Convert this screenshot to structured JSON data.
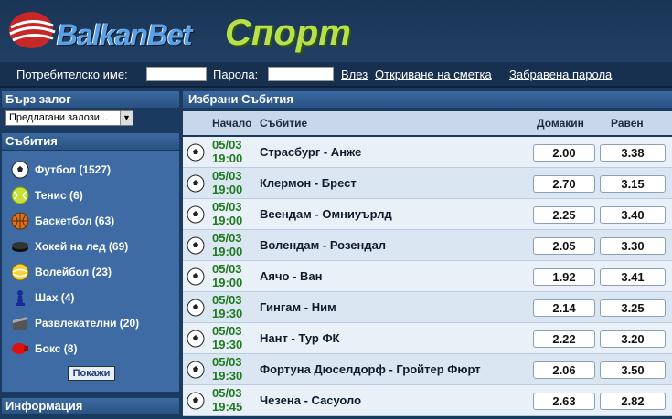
{
  "header": {
    "logo_name": "BalkanBet",
    "logo_sport": "Спорт"
  },
  "login": {
    "username_label": "Потребителско име:",
    "password_label": "Парола:",
    "login_link": "Влез",
    "open_account_link": "Откриване на сметка",
    "forgot_password_link": "Забравена парола"
  },
  "sidebar": {
    "quick_bet_title": "Бърз залог",
    "quick_bet_select": "Предлагани залози...",
    "events_title": "Събития",
    "sports": [
      {
        "label": "Футбол (1527)",
        "icon": "football-icon"
      },
      {
        "label": "Тенис (6)",
        "icon": "tennis-icon"
      },
      {
        "label": "Баскетбол (63)",
        "icon": "basketball-icon"
      },
      {
        "label": "Хокей на лед (69)",
        "icon": "hockey-puck-icon"
      },
      {
        "label": "Волейбол (23)",
        "icon": "volleyball-icon"
      },
      {
        "label": "Шах (4)",
        "icon": "chess-pawn-icon"
      },
      {
        "label": "Развлекателни (20)",
        "icon": "entertainment-icon"
      },
      {
        "label": "Бокс (8)",
        "icon": "boxing-glove-icon"
      }
    ],
    "show_button": "Покажи",
    "info_title": "Информация"
  },
  "main": {
    "title": "Избрани Събития",
    "columns": {
      "start": "Начало",
      "event": "Събитие",
      "home": "Домакин",
      "draw": "Равен"
    },
    "events": [
      {
        "date": "05/03",
        "time": "19:00",
        "event": "Страсбург - Анже",
        "home": "2.00",
        "draw": "3.38"
      },
      {
        "date": "05/03",
        "time": "19:00",
        "event": "Клермон - Брест",
        "home": "2.70",
        "draw": "3.15"
      },
      {
        "date": "05/03",
        "time": "19:00",
        "event": "Веендам - Омниуърлд",
        "home": "2.25",
        "draw": "3.40"
      },
      {
        "date": "05/03",
        "time": "19:00",
        "event": "Волендам - Розендал",
        "home": "2.05",
        "draw": "3.30"
      },
      {
        "date": "05/03",
        "time": "19:00",
        "event": "Аячо - Ван",
        "home": "1.92",
        "draw": "3.41"
      },
      {
        "date": "05/03",
        "time": "19:30",
        "event": "Гингам - Ним",
        "home": "2.14",
        "draw": "3.25"
      },
      {
        "date": "05/03",
        "time": "19:30",
        "event": "Нант - Тур ФК",
        "home": "2.22",
        "draw": "3.20"
      },
      {
        "date": "05/03",
        "time": "19:30",
        "event": "Фортуна Дюселдорф - Гройтер Фюрт",
        "home": "2.06",
        "draw": "3.50"
      },
      {
        "date": "05/03",
        "time": "19:45",
        "event": "Чезена - Сасуоло",
        "home": "2.63",
        "draw": "2.82"
      }
    ]
  }
}
